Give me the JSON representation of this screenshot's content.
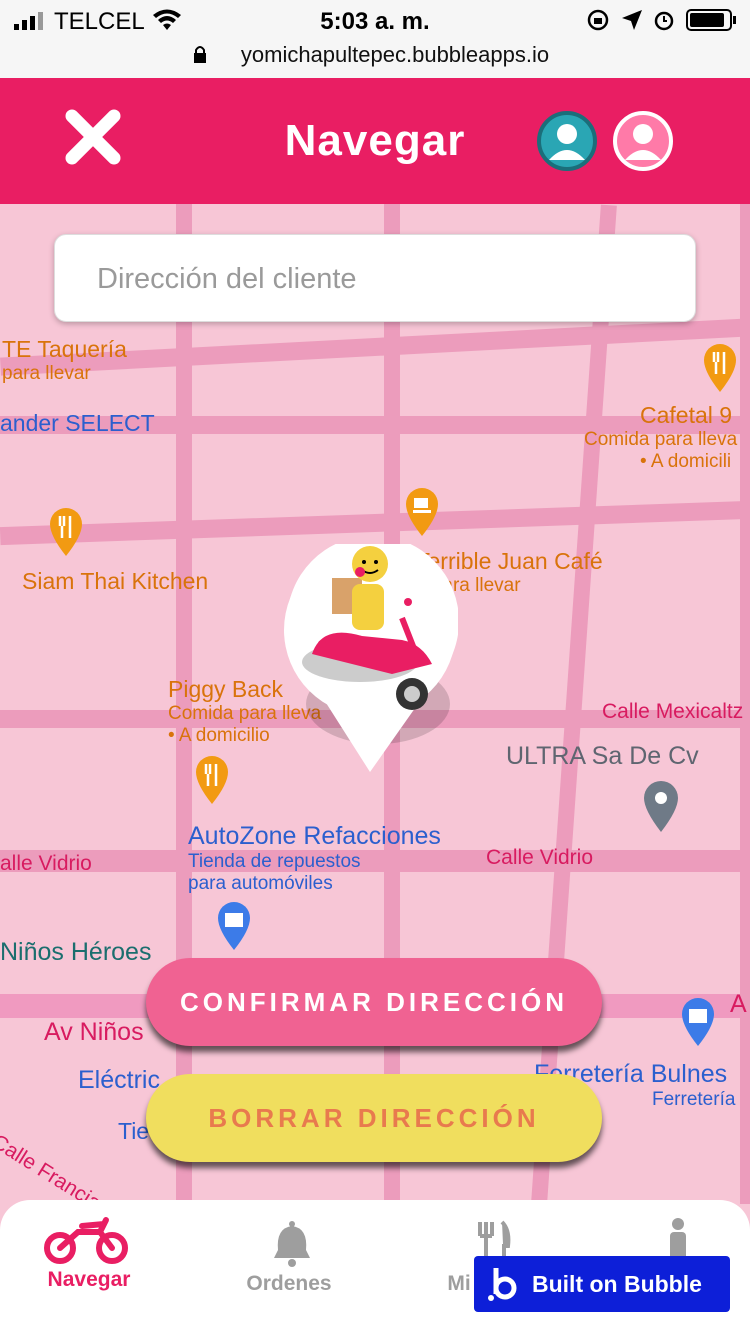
{
  "status_bar": {
    "carrier": "TELCEL",
    "time": "5:03 a. m.",
    "url": "yomichapultepec.bubbleapps.io"
  },
  "header": {
    "title": "Navegar",
    "close_icon": "close-icon",
    "colors": {
      "background": "#e91e63",
      "avatar_active": "#2aa6b4",
      "avatar_inactive": "#ff7aa8"
    }
  },
  "search": {
    "placeholder": "Dirección del cliente",
    "value": ""
  },
  "map": {
    "pois": [
      {
        "name": "TE Taquería",
        "sub": "para llevar"
      },
      {
        "name": "ander SELECT"
      },
      {
        "name": "Cafetal 9",
        "sub": "Comida para lleva",
        "sub2": "• A domicili"
      },
      {
        "name": "Siam Thai Kitchen"
      },
      {
        "name": "Terrible Juan Café",
        "sub": "a para llevar"
      },
      {
        "name": "Piggy Back",
        "sub": "Comida para lleva",
        "sub2": "• A domicilio"
      },
      {
        "name": "Calle Mexicaltz"
      },
      {
        "name": "ULTRA Sa De Cv"
      },
      {
        "name": "AutoZone Refacciones",
        "sub": "Tienda de repuestos",
        "sub2": "para automóviles"
      },
      {
        "name": "alle Vidrio"
      },
      {
        "name": "Calle Vidrio"
      },
      {
        "name": "Niños Héroes"
      },
      {
        "name": "Av Niños"
      },
      {
        "name": "Eléctric"
      },
      {
        "name": "Ferretería Bulnes",
        "sub": "Ferretería"
      },
      {
        "name": "Calle Francia"
      },
      {
        "name": "Tie"
      },
      {
        "name": "A"
      }
    ],
    "marker": "delivery-scooter-marker"
  },
  "buttons": {
    "confirm": "CONFIRMAR DIRECCIÓN",
    "clear": "BORRAR DIRECCIÓN"
  },
  "nav": {
    "items": [
      {
        "label": "Navegar",
        "icon": "motorcycle-icon",
        "active": true
      },
      {
        "label": "Ordenes",
        "icon": "bell-icon",
        "active": false
      },
      {
        "label": "Mi",
        "icon": "utensils-icon",
        "active": false
      },
      {
        "label": "",
        "icon": "person-icon",
        "active": false
      }
    ],
    "colors": {
      "active": "#e91e63",
      "inactive": "#9e9e9e"
    }
  },
  "bubble_badge": {
    "label": "Built on Bubble"
  }
}
